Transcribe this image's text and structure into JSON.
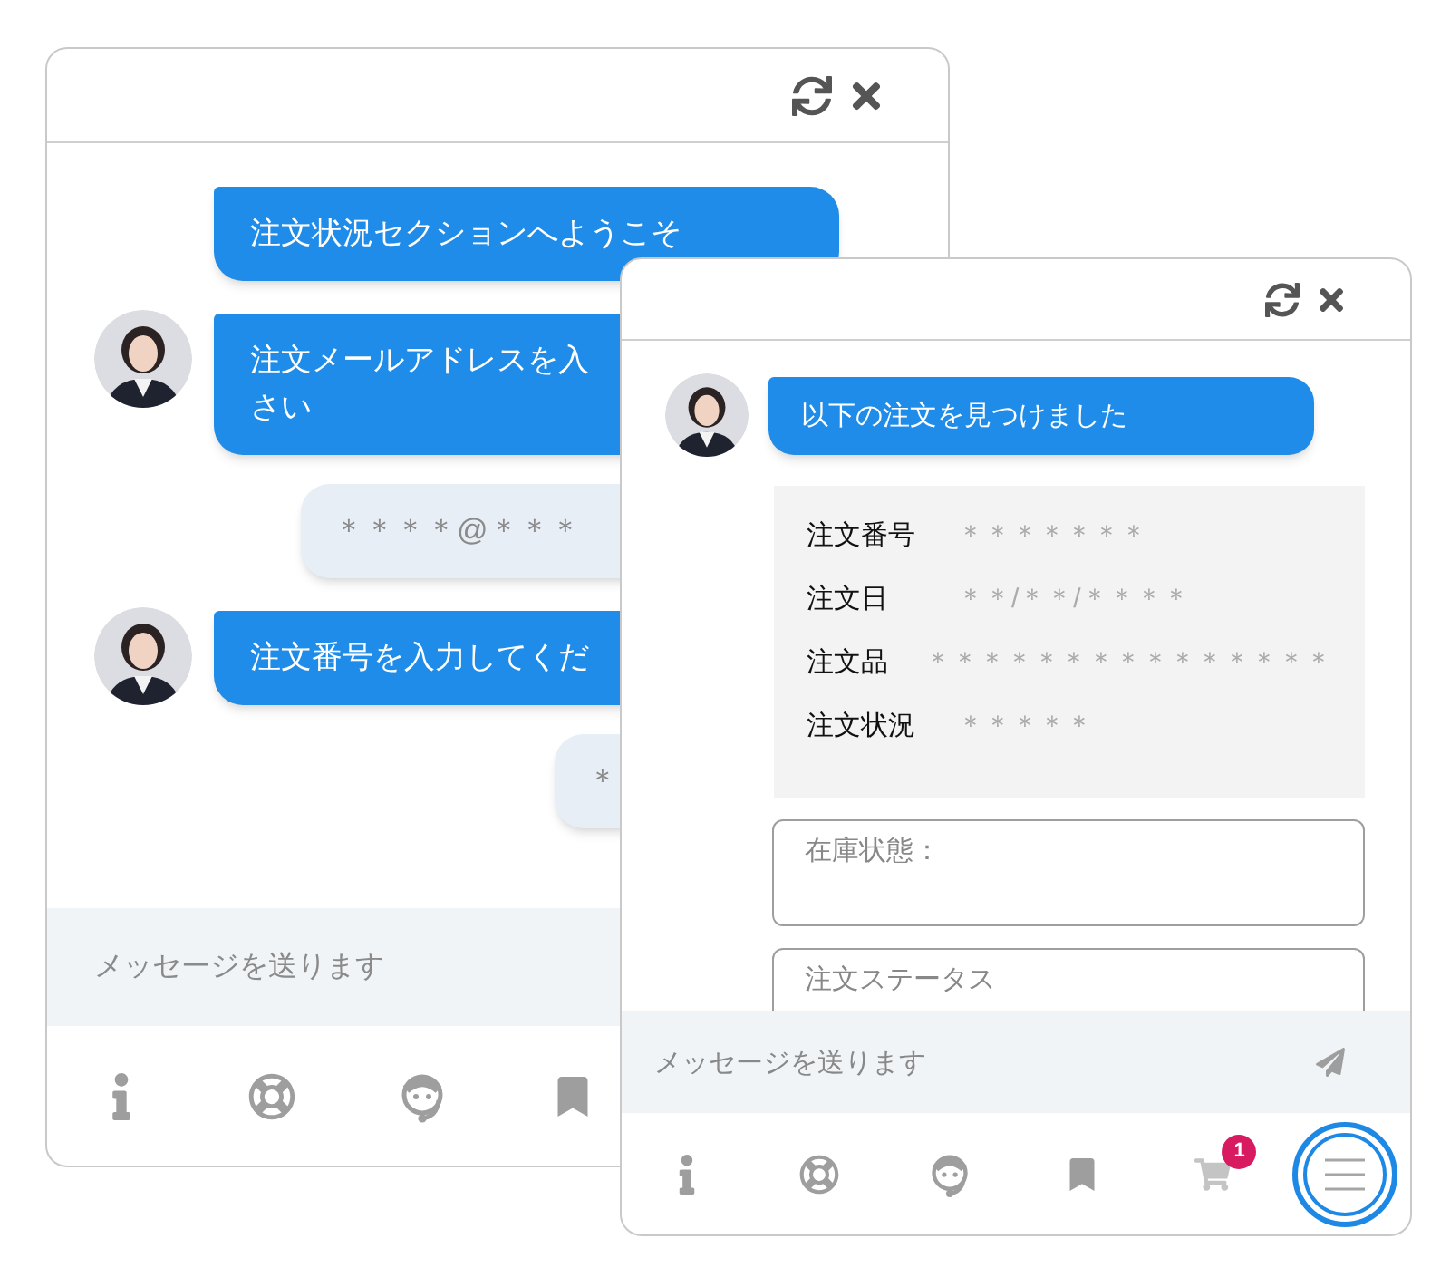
{
  "back_window": {
    "messages": [
      {
        "kind": "bot",
        "avatar": false,
        "lines": [
          "注文状況セクションへようこそ"
        ]
      },
      {
        "kind": "bot",
        "avatar": true,
        "lines": [
          "注文メールアドレスを入",
          "さい"
        ]
      },
      {
        "kind": "user",
        "lines": [
          "＊＊＊＊@＊＊＊"
        ]
      },
      {
        "kind": "bot",
        "avatar": true,
        "lines": [
          "注文番号を入力してくだ"
        ]
      },
      {
        "kind": "user",
        "lines": [
          "＊"
        ]
      }
    ],
    "composer": {
      "placeholder": "メッセージを送ります"
    },
    "toolbar": [
      {
        "kind": "info"
      },
      {
        "kind": "lifebuoy"
      },
      {
        "kind": "agent"
      },
      {
        "kind": "bookmark"
      }
    ]
  },
  "front_window": {
    "message": {
      "avatar": true,
      "text": "以下の注文を見つけました"
    },
    "order": [
      {
        "label": "注文番号",
        "value": "＊＊＊＊＊＊＊"
      },
      {
        "label": "注文日",
        "value": "＊＊/＊＊/＊＊＊＊"
      },
      {
        "label": "注文品",
        "value": "＊＊＊＊＊＊＊＊＊＊＊＊＊＊＊"
      },
      {
        "label": "注文状況",
        "value": "＊＊＊＊＊"
      }
    ],
    "fields": [
      {
        "placeholder": "在庫状態："
      },
      {
        "placeholder": "注文ステータス"
      }
    ],
    "composer": {
      "placeholder": "メッセージを送ります"
    },
    "toolbar": [
      {
        "kind": "info",
        "selected": false
      },
      {
        "kind": "lifebuoy",
        "selected": false
      },
      {
        "kind": "agent",
        "selected": false
      },
      {
        "kind": "bookmark",
        "selected": false
      },
      {
        "kind": "cart",
        "selected": false,
        "badge": "1"
      },
      {
        "kind": "menu",
        "selected": true
      }
    ]
  }
}
